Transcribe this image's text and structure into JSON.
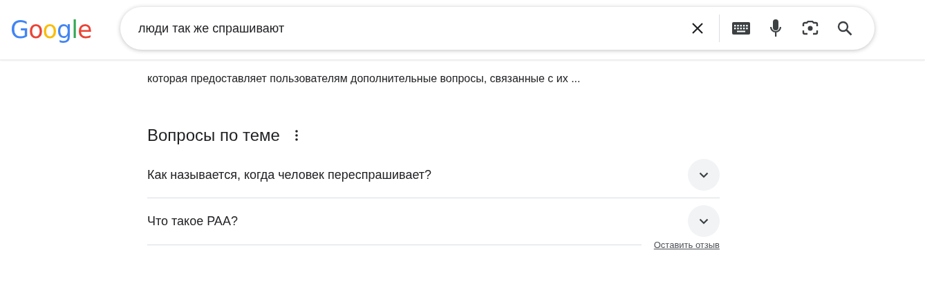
{
  "logo": {
    "text": "Google"
  },
  "search": {
    "value": "люди так же спрашивают"
  },
  "snippet": {
    "text": "которая предоставляет пользователям дополнительные вопросы, связанные с их ..."
  },
  "related": {
    "title": "Вопросы по теме",
    "questions": [
      {
        "text": "Как называется, когда человек переспрашивает?",
        "expanded": false
      },
      {
        "text": "Что такое PAA?",
        "expanded": false
      }
    ],
    "feedback": "Оставить отзыв"
  }
}
